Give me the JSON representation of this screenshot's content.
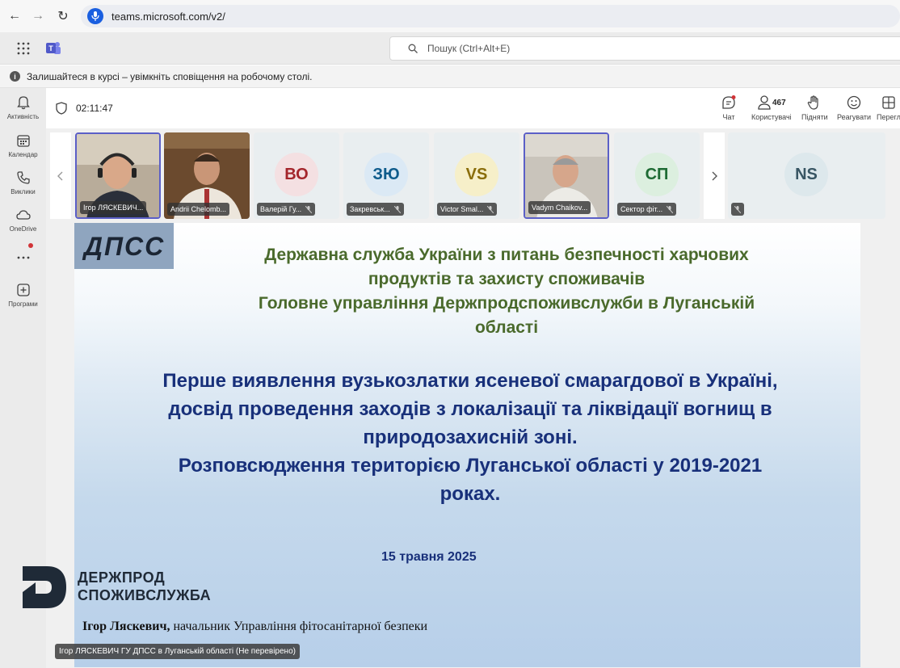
{
  "browser": {
    "url": "teams.microsoft.com/v2/"
  },
  "header": {
    "search_placeholder": "Пошук (Ctrl+Alt+E)"
  },
  "notice": {
    "text": "Залишайтеся в курсі – увімкніть сповіщення на робочому столі."
  },
  "rail": {
    "items": [
      {
        "label": "Активність",
        "icon": "bell-icon"
      },
      {
        "label": "Календар",
        "icon": "calendar-icon"
      },
      {
        "label": "Виклики",
        "icon": "phone-icon"
      },
      {
        "label": "OneDrive",
        "icon": "cloud-icon"
      },
      {
        "label": "",
        "icon": "more-icon"
      },
      {
        "label": "Програми",
        "icon": "add-apps-icon"
      }
    ]
  },
  "meeting": {
    "timer": "02:11:47",
    "toolbar": {
      "chat_label": "Чат",
      "people_label": "Користувачі",
      "people_count": "467",
      "raise_label": "Підняти",
      "react_label": "Реагувати",
      "view_label": "Перегл"
    }
  },
  "participants": [
    {
      "name": "Ігор ЛЯСКЕВИЧ...",
      "initials": "",
      "video": true,
      "active": true
    },
    {
      "name": "Andrii Chelomb...",
      "initials": "",
      "video": true,
      "active": false
    },
    {
      "name": "Валерій Гу...",
      "initials": "ВО",
      "video": false,
      "active": false,
      "bg": "#f4e0e2",
      "fg": "#a4262c"
    },
    {
      "name": "Закревськ...",
      "initials": "ЗЮ",
      "video": false,
      "active": false,
      "bg": "#dbe9f5",
      "fg": "#0f5c8c"
    },
    {
      "name": "Victor Smal...",
      "initials": "VS",
      "video": false,
      "active": false,
      "bg": "#f6efc9",
      "fg": "#8a6d0a"
    },
    {
      "name": "Vadym Chaikov...",
      "initials": "",
      "video": true,
      "active": true
    },
    {
      "name": "Сектор фіт...",
      "initials": "СП",
      "video": false,
      "active": false,
      "bg": "#dcefdf",
      "fg": "#1e6b34"
    },
    {
      "name": "",
      "initials": "NS",
      "video": false,
      "active": false,
      "bg": "#dde8ec",
      "fg": "#385563"
    }
  ],
  "slide": {
    "logo_text": "ДПСС",
    "org_lines": [
      "Державна служба України з питань безпечності харчових",
      "продуктів та захисту споживачів",
      "Головне управління Держпродспоживслужби в Луганській",
      "області"
    ],
    "title_lines": [
      "Перше виявлення вузькозлатки ясеневої смарагдової в Україні,",
      "досвід проведення заходів з локалізації та ліквідації вогнищ в",
      "природозахисній зоні.",
      "Розповсюдження територією Луганської області у 2019-2021",
      "роках."
    ],
    "date": "15 травня 2025",
    "brand_line1": "ДЕРЖПРОД",
    "brand_line2": "СПОЖИВСЛУЖБА",
    "speaker_name": "Ігор Ляскевич,",
    "speaker_role": "начальник Управління фітосанітарної безпеки"
  },
  "caption": "Ігор ЛЯСКЕВИЧ ГУ ДПСС в Луганській області (Не перевірено)"
}
